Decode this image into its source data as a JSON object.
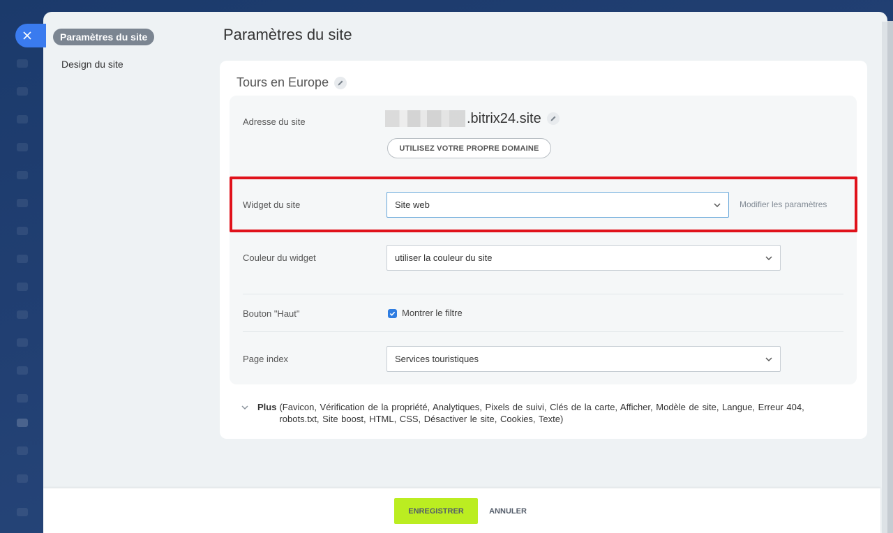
{
  "nav": {
    "close_icon": "close-icon",
    "menu_items": [
      {
        "label": "Paramètres du site",
        "active": true
      },
      {
        "label": "Design du site",
        "active": false
      }
    ]
  },
  "page": {
    "title": "Paramètres du site"
  },
  "site": {
    "name": "Tours en Europe",
    "address_label": "Adresse du site",
    "domain_suffix": ".bitrix24.site",
    "own_domain_button": "UTILISEZ VOTRE PROPRE DOMAINE"
  },
  "widget": {
    "label": "Widget du site",
    "value": "Site web",
    "modify_link": "Modifier les paramètres"
  },
  "widget_color": {
    "label": "Couleur du widget",
    "value": "utiliser la couleur du site"
  },
  "top_button": {
    "label": "Bouton \"Haut\"",
    "checkbox_label": "Montrer le filtre",
    "checked": true
  },
  "index_page": {
    "label": "Page index",
    "value": "Services touristiques"
  },
  "more": {
    "title": "Plus",
    "items": "(Favicon,  Vérification de la propriété,  Analytiques,  Pixels de suivi,  Clés de la carte,  Afficher,  Modèle de site,  Langue,  Erreur 404,  robots.txt,  Site boost,  HTML,  CSS,  Désactiver le site,  Cookies,  Texte)"
  },
  "footer": {
    "save": "ENREGISTRER",
    "cancel": "ANNULER"
  },
  "colors": {
    "accent_blue": "#3a7bef",
    "save_green": "#bbed21",
    "highlight_red": "#e0121b"
  }
}
